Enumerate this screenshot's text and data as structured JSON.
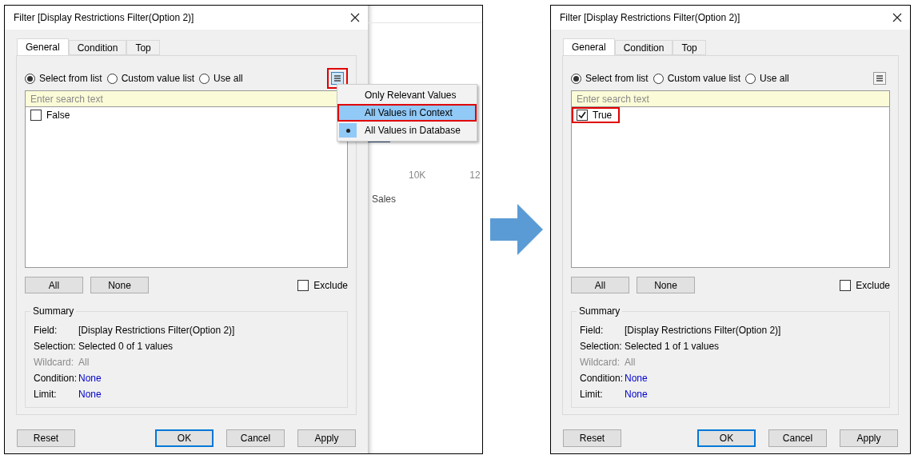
{
  "panels": [
    {
      "dialog": {
        "title": "Filter [Display Restrictions Filter(Option 2)]",
        "tabs": [
          {
            "label": "General",
            "selected": true
          },
          {
            "label": "Condition",
            "selected": false
          },
          {
            "label": "Top",
            "selected": false
          }
        ],
        "radios": [
          {
            "label": "Select from list",
            "selected": true
          },
          {
            "label": "Custom value list",
            "selected": false
          },
          {
            "label": "Use all",
            "selected": false
          }
        ],
        "menu_button": {
          "highlighted": true
        },
        "search": {
          "placeholder": "Enter search text"
        },
        "values": [
          {
            "label": "False",
            "checked": false,
            "highlighted": false
          }
        ],
        "list_buttons": [
          "All",
          "None"
        ],
        "exclude": {
          "label": "Exclude",
          "checked": false
        },
        "summary": {
          "title": "Summary",
          "rows": [
            {
              "label": "Field:",
              "value": "[Display Restrictions Filter(Option 2)]",
              "kind": "normal"
            },
            {
              "label": "Selection:",
              "value": "Selected 0 of 1 values",
              "kind": "normal"
            },
            {
              "label": "Wildcard:",
              "value": "All",
              "kind": "disabled"
            },
            {
              "label": "Condition:",
              "value": "None",
              "kind": "link"
            },
            {
              "label": "Limit:",
              "value": "None",
              "kind": "link"
            }
          ]
        },
        "footer_buttons": [
          {
            "label": "Reset",
            "default": false
          },
          {
            "label": "OK",
            "default": true
          },
          {
            "label": "Cancel",
            "default": false
          },
          {
            "label": "Apply",
            "default": false
          }
        ]
      },
      "sheet": {
        "axis_labels": [
          "10K",
          "12"
        ],
        "axis_title": "Sales"
      },
      "menu": {
        "items": [
          {
            "label": "Only Relevant Values",
            "selected": false,
            "hovered": false,
            "highlighted": false
          },
          {
            "label": "All Values in Context",
            "selected": false,
            "hovered": true,
            "highlighted": true
          },
          {
            "label": "All Values in Database",
            "selected": true,
            "hovered": false,
            "highlighted": false
          }
        ]
      }
    },
    {
      "dialog": {
        "title": "Filter [Display Restrictions Filter(Option 2)]",
        "tabs": [
          {
            "label": "General",
            "selected": true
          },
          {
            "label": "Condition",
            "selected": false
          },
          {
            "label": "Top",
            "selected": false
          }
        ],
        "radios": [
          {
            "label": "Select from list",
            "selected": true
          },
          {
            "label": "Custom value list",
            "selected": false
          },
          {
            "label": "Use all",
            "selected": false
          }
        ],
        "menu_button": {
          "highlighted": false
        },
        "search": {
          "placeholder": "Enter search text"
        },
        "values": [
          {
            "label": "True",
            "checked": true,
            "highlighted": true
          }
        ],
        "list_buttons": [
          "All",
          "None"
        ],
        "exclude": {
          "label": "Exclude",
          "checked": false
        },
        "summary": {
          "title": "Summary",
          "rows": [
            {
              "label": "Field:",
              "value": "[Display Restrictions Filter(Option 2)]",
              "kind": "normal"
            },
            {
              "label": "Selection:",
              "value": "Selected 1 of 1 values",
              "kind": "normal"
            },
            {
              "label": "Wildcard:",
              "value": "All",
              "kind": "disabled"
            },
            {
              "label": "Condition:",
              "value": "None",
              "kind": "link"
            },
            {
              "label": "Limit:",
              "value": "None",
              "kind": "link"
            }
          ]
        },
        "footer_buttons": [
          {
            "label": "Reset",
            "default": false
          },
          {
            "label": "OK",
            "default": true
          },
          {
            "label": "Cancel",
            "default": false
          },
          {
            "label": "Apply",
            "default": false
          }
        ]
      }
    }
  ]
}
